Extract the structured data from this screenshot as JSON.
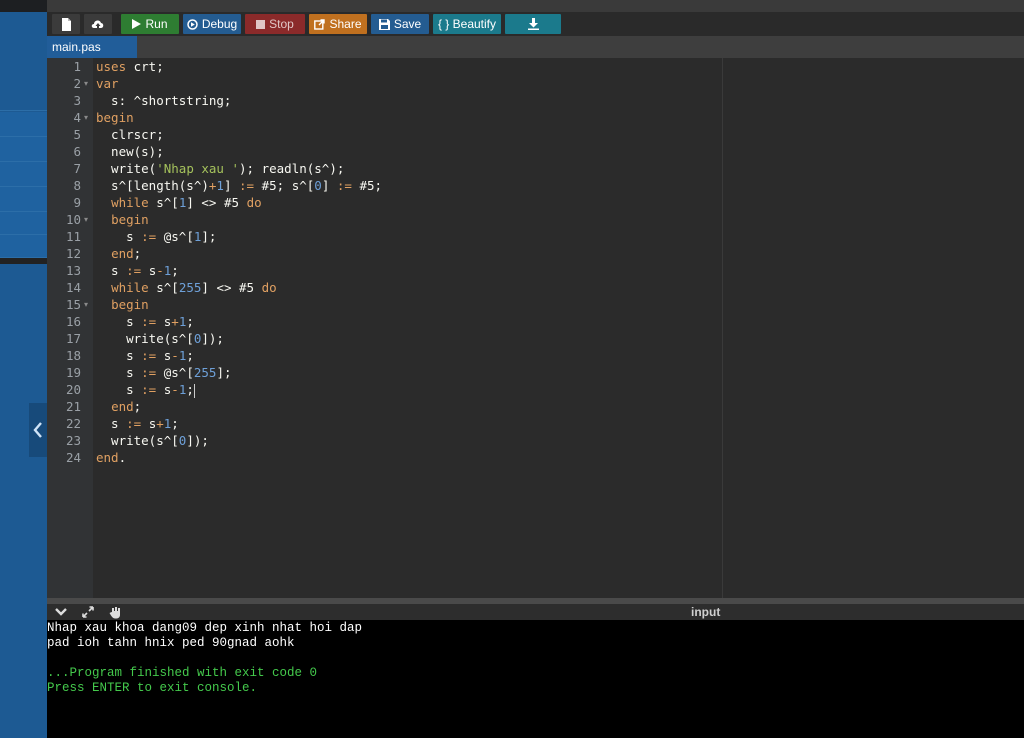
{
  "toolbar": {
    "run_label": "Run",
    "debug_label": "Debug",
    "stop_label": "Stop",
    "share_label": "Share",
    "save_label": "Save",
    "beautify_label": "{ } Beautify"
  },
  "tab": {
    "filename": "main.pas"
  },
  "editor": {
    "line_numbers": [
      "1",
      "2",
      "3",
      "4",
      "5",
      "6",
      "7",
      "8",
      "9",
      "10",
      "11",
      "12",
      "13",
      "14",
      "15",
      "16",
      "17",
      "18",
      "19",
      "20",
      "21",
      "22",
      "23",
      "24"
    ],
    "lines": [
      "uses crt;",
      "var",
      "  s: ^shortstring;",
      "begin",
      "  clrscr;",
      "  new(s);",
      "  write('Nhap xau '); readln(s^);",
      "  s^[length(s^)+1] := #5; s^[0] := #5;",
      "  while s^[1] <> #5 do",
      "  begin",
      "    s := @s^[1];",
      "  end;",
      "  s := s-1;",
      "  while s^[255] <> #5 do",
      "  begin",
      "    s := s+1;",
      "    write(s^[0]);",
      "    s := s-1;",
      "    s := @s^[255];",
      "    s := s-1;",
      "  end;",
      "  s := s+1;",
      "  write(s^[0]);",
      "end."
    ]
  },
  "console": {
    "header_label": "input",
    "output_lines": [
      "Nhap xau khoa dang09 dep xinh nhat hoi dap",
      "pad ioh tahn hnix ped 90gnad aohk",
      "",
      "...Program finished with exit code 0",
      "Press ENTER to exit console."
    ]
  },
  "colors": {
    "run": "#2e7d32",
    "debug": "#245c91",
    "stop": "#8b2a2a",
    "share": "#c0701f",
    "beautify": "#1b7a8c",
    "console_green": "#44c94c"
  }
}
